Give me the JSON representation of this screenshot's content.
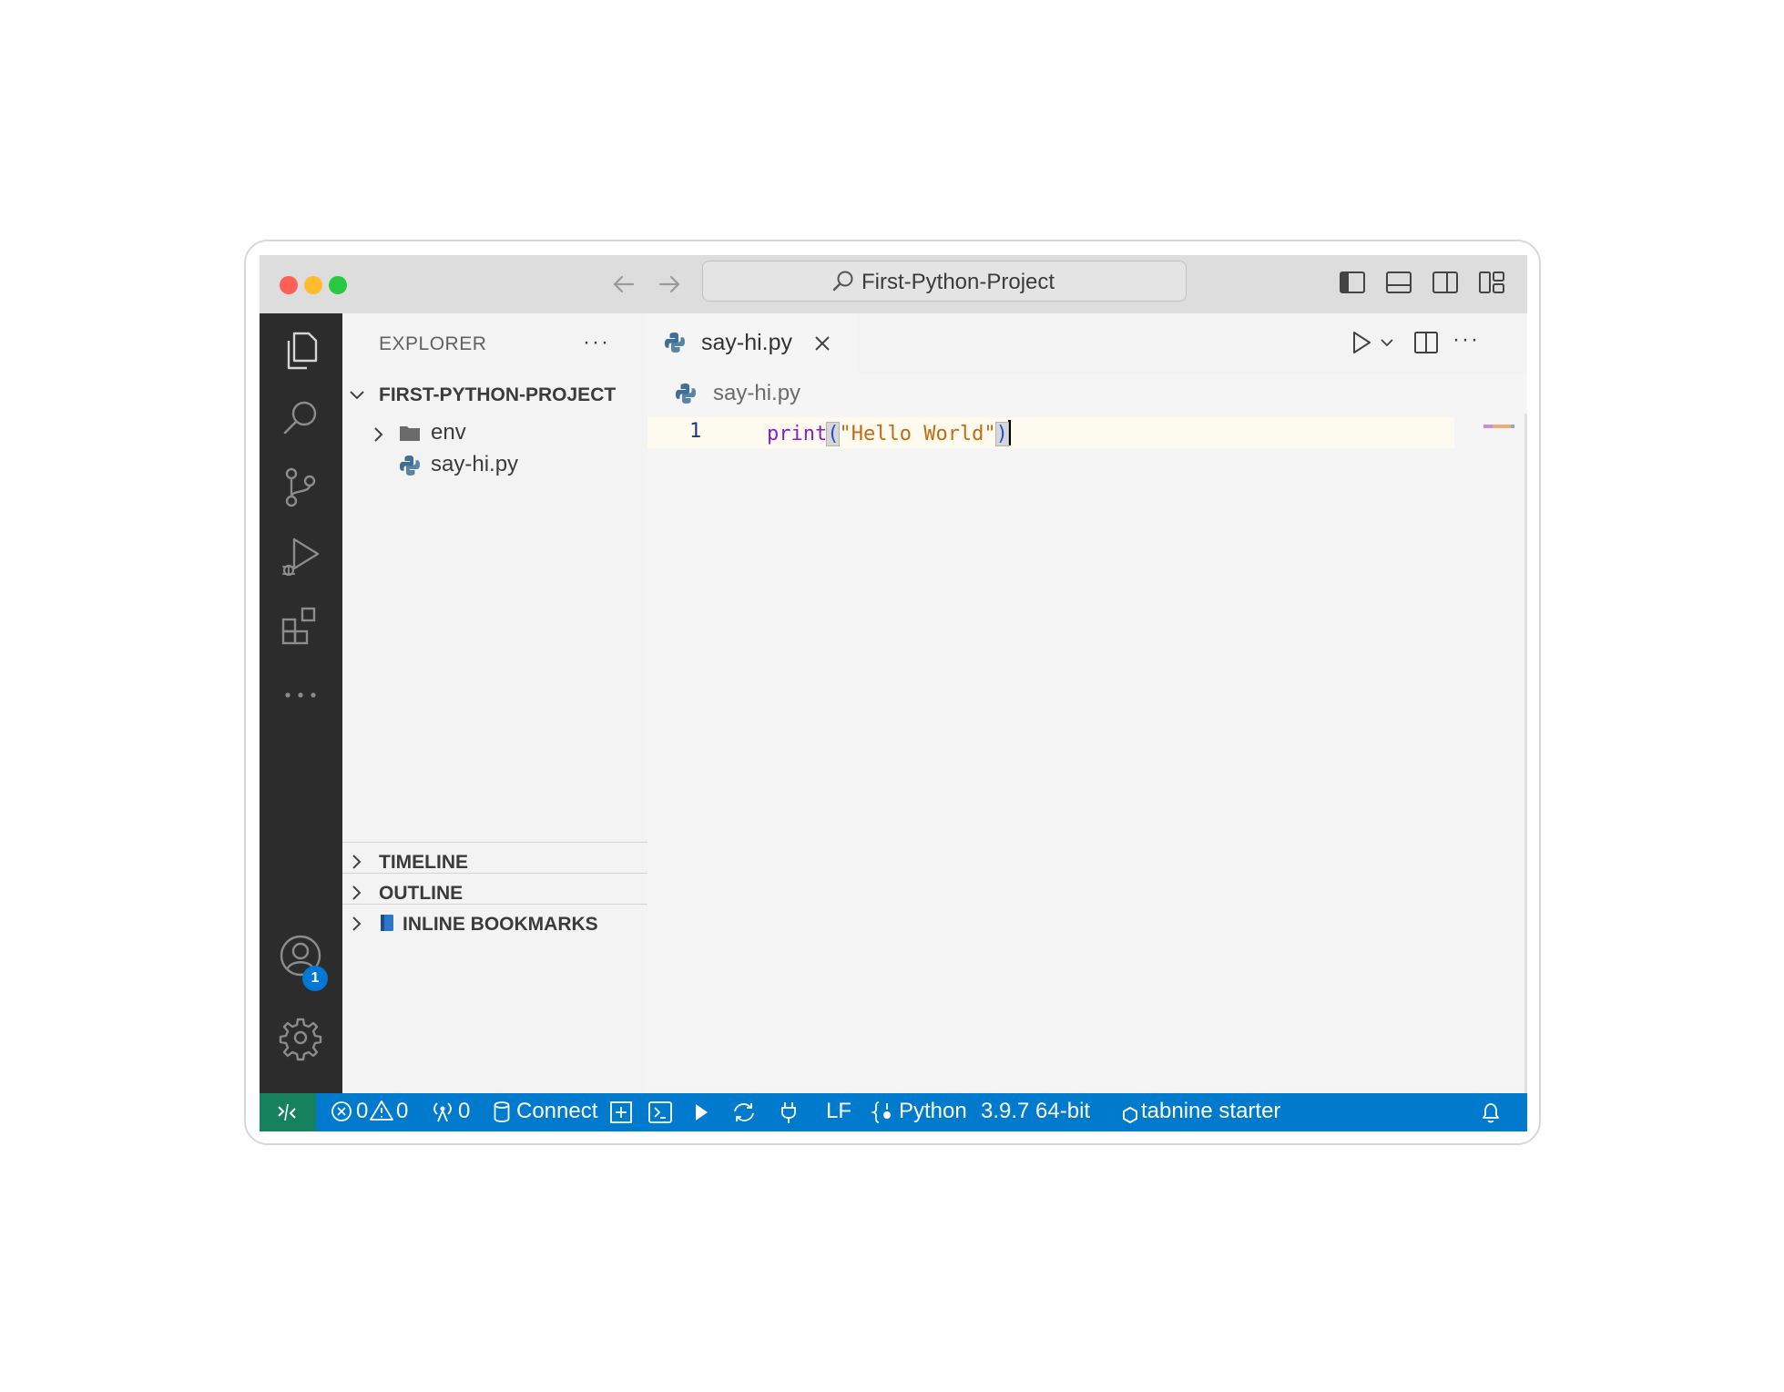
{
  "window": {
    "command_center": "First-Python-Project"
  },
  "activity_bar": {
    "accounts_badge": "1"
  },
  "explorer": {
    "title": "EXPLORER",
    "more": "···",
    "project": "FIRST-PYTHON-PROJECT",
    "items": [
      {
        "label": "env",
        "type": "folder"
      },
      {
        "label": "say-hi.py",
        "type": "python-file"
      }
    ],
    "sections": [
      "TIMELINE",
      "OUTLINE",
      "INLINE BOOKMARKS"
    ]
  },
  "editor": {
    "tab_label": "say-hi.py",
    "breadcrumb": "say-hi.py",
    "line_number": "1",
    "code": {
      "keyword": "print",
      "open_paren": "(",
      "string": "\"Hello World\"",
      "close_paren": ")"
    },
    "actions_more": "···"
  },
  "statusbar": {
    "errors": "0",
    "warnings": "0",
    "ports": "0",
    "connect": "Connect",
    "eol": "LF",
    "language": "Python",
    "interpreter": "3.9.7 64-bit",
    "tabnine": "tabnine starter"
  },
  "colors": {
    "status_bar": "#007acc",
    "remote_indicator": "#16825d",
    "activity_bar": "#2c2c2c",
    "badge": "#0078d4"
  }
}
